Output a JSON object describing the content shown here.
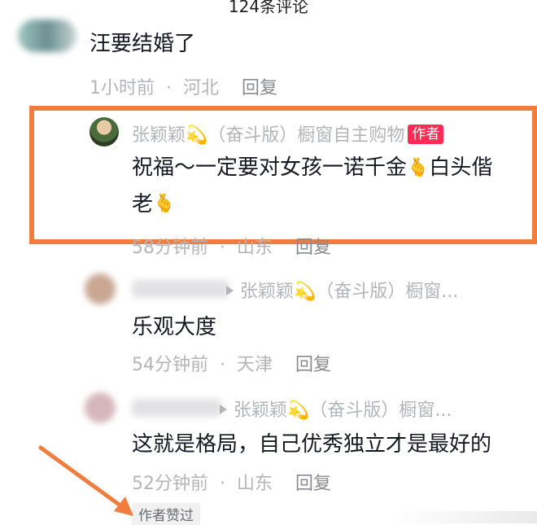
{
  "header": {
    "title": "124条评论"
  },
  "comments": [
    {
      "content": "汪要结婚了",
      "time": "1小时前",
      "location": "河北",
      "reply_label": "回复"
    },
    {
      "author": "张颖颖💫（奋斗版）橱窗自主购物",
      "author_tag": "作者",
      "content_line1": "祝福～一定要对女孩一诺千金",
      "content_line1_end": "白头偕",
      "content_line2": "老",
      "emoji": "🫰",
      "time": "58分钟前",
      "location": "山东",
      "reply_label": "回复"
    },
    {
      "reply_to": "张颖颖💫（奋斗版）橱窗...",
      "content": "乐观大度",
      "time": "54分钟前",
      "location": "天津",
      "reply_label": "回复"
    },
    {
      "reply_to": "张颖颖💫（奋斗版）橱窗...",
      "content": "这就是格局，自己优秀独立才是最好的",
      "time": "52分钟前",
      "location": "山东",
      "reply_label": "回复",
      "liked_badge": "作者赞过"
    }
  ],
  "colors": {
    "highlight": "#f07c3e",
    "arrow": "#f07c3e",
    "author_tag": "#fe2c55"
  }
}
